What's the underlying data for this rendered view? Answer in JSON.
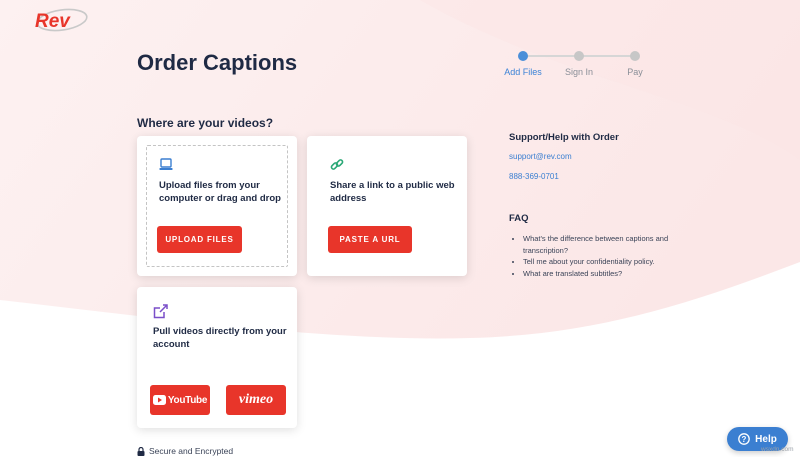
{
  "header": {
    "logo_text": "Rev",
    "page_title": "Order Captions"
  },
  "steps": [
    {
      "label": "Add Files",
      "active": true
    },
    {
      "label": "Sign In",
      "active": false
    },
    {
      "label": "Pay",
      "active": false
    }
  ],
  "main": {
    "section_heading": "Where are your videos?",
    "cards": {
      "upload": {
        "icon": "laptop-icon",
        "text": "Upload files from your computer or drag and drop",
        "button_label": "UPLOAD FILES"
      },
      "url": {
        "icon": "link-icon",
        "text": "Share a link to a public web address",
        "button_label": "PASTE A URL"
      },
      "account": {
        "icon": "share-out-icon",
        "text": "Pull videos directly from your account",
        "youtube_label": "YouTube",
        "vimeo_label": "vimeo"
      }
    },
    "secure_text": "Secure and Encrypted"
  },
  "sidebar": {
    "support_heading": "Support/Help with Order",
    "email": "support@rev.com",
    "phone": "888-369-0701",
    "faq_heading": "FAQ",
    "faq_items": [
      "What's the difference between captions and transcription?",
      "Tell me about your confidentiality policy.",
      "What are translated subtitles?"
    ]
  },
  "help_button": {
    "label": "Help",
    "icon": "question-circle-icon"
  },
  "watermark": "wsxdn.com",
  "colors": {
    "brand_red": "#e8352a",
    "link_blue": "#3b7fd1",
    "step_active": "#4a8fd9",
    "title_navy": "#1f2a44",
    "background_blush": "#fdeeee"
  }
}
